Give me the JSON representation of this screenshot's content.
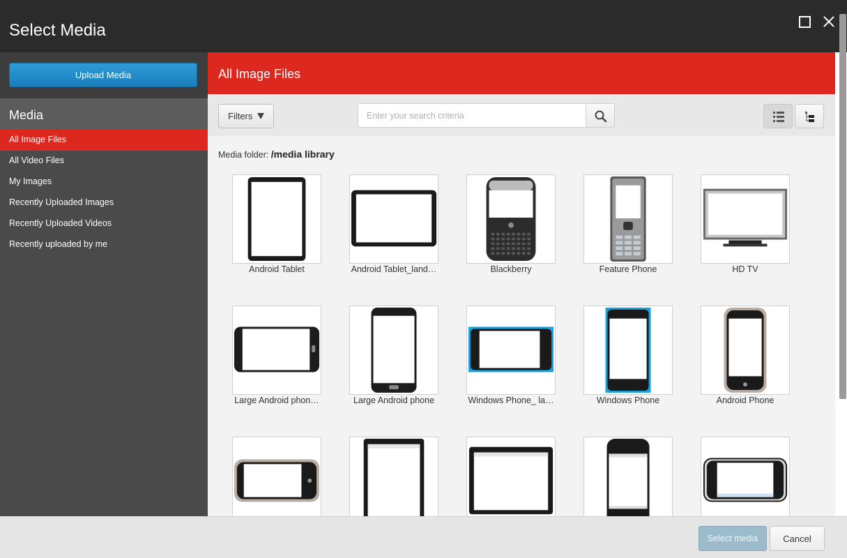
{
  "window": {
    "title": "Select Media",
    "maximize_icon": "maximize-icon",
    "close_icon": "close-icon"
  },
  "sidebar": {
    "upload_label": "Upload Media",
    "heading": "Media",
    "items": [
      {
        "label": "All Image Files",
        "active": true
      },
      {
        "label": "All Video Files",
        "active": false
      },
      {
        "label": "My Images",
        "active": false
      },
      {
        "label": "Recently Uploaded Images",
        "active": false
      },
      {
        "label": "Recently Uploaded Videos",
        "active": false
      },
      {
        "label": "Recently uploaded by me",
        "active": false
      }
    ]
  },
  "main": {
    "title": "All Image Files",
    "filters_label": "Filters",
    "search": {
      "placeholder": "Enter your search criteria",
      "value": ""
    },
    "search_icon": "search-icon",
    "view_icons": [
      "list-view-icon",
      "tree-view-icon"
    ],
    "folder_prefix": "Media folder:",
    "folder_path": "/media library",
    "items": [
      {
        "label": "Android Tablet",
        "device": "tablet-portrait"
      },
      {
        "label": "Android Tablet_land…",
        "device": "tablet-landscape"
      },
      {
        "label": "Blackberry",
        "device": "blackberry"
      },
      {
        "label": "Feature Phone",
        "device": "feature-phone"
      },
      {
        "label": "HD TV",
        "device": "tv"
      },
      {
        "label": "Large Android phon…",
        "device": "phone-landscape"
      },
      {
        "label": "Large Android phone",
        "device": "phone-portrait"
      },
      {
        "label": "Windows Phone_ la…",
        "device": "winphone-landscape"
      },
      {
        "label": "Windows Phone",
        "device": "winphone-portrait"
      },
      {
        "label": "Android Phone",
        "device": "android-phone"
      },
      {
        "label": "",
        "device": "android-landscape"
      },
      {
        "label": "",
        "device": "ipad-portrait"
      },
      {
        "label": "",
        "device": "ipad-landscape"
      },
      {
        "label": "",
        "device": "iphone-portrait"
      },
      {
        "label": "",
        "device": "iphone-landscape"
      }
    ]
  },
  "footer": {
    "select_label": "Select media",
    "cancel_label": "Cancel"
  },
  "colors": {
    "accent_red": "#dd2820",
    "upload_blue": "#1a7fbc",
    "titlebar": "#2b2b2b",
    "sidebar": "#4a4a4a",
    "winphone_blue": "#1ca0e0"
  }
}
